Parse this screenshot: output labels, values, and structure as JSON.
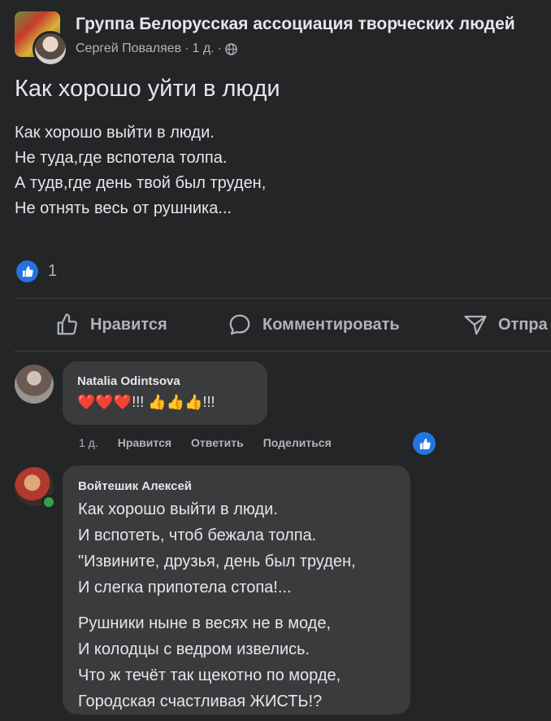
{
  "post": {
    "group_name": "Группа Белорусская ассоциация творческих людей",
    "author": "Сергей Поваляев",
    "time": "1 д.",
    "separator": "·",
    "title": "Как хорошо уйти в люди",
    "body_lines": [
      "Как хорошо выйти в люди.",
      "Не туда,где вспотела толпа.",
      "А тудв,где день твой был труден,",
      "Не отнять весь от рушника..."
    ],
    "like_count": "1"
  },
  "actions": {
    "like": "Нравится",
    "comment": "Комментировать",
    "share": "Отпра"
  },
  "comments": [
    {
      "name": "Natalia Odintsova",
      "text": "❤️❤️❤️!!! 👍👍👍!!!",
      "time": "1 д.",
      "like": "Нравится",
      "reply": "Ответить",
      "share": "Поделиться"
    },
    {
      "name": "Войтешик Алексей",
      "stanza1": [
        "Как хорошо выйти в люди.",
        "И вспотеть, чтоб бежала толпа.",
        "\"Извините, друзья, день был труден,",
        "И слегка припотела стопа!..."
      ],
      "stanza2": [
        "Рушники ныне в весях не в моде,",
        "И колодцы с ведром извелись.",
        "Что ж течёт так щекотно по морде,",
        "Городская счастливая ЖИСТЬ!?"
      ]
    }
  ],
  "colors": {
    "background": "#242526",
    "bubble": "#3a3b3c",
    "like_blue": "#2374e1",
    "online_green": "#31a24c"
  },
  "icons": [
    "globe-icon",
    "like-icon",
    "thumbs-up-outline-icon",
    "comment-icon",
    "share-icon"
  ]
}
